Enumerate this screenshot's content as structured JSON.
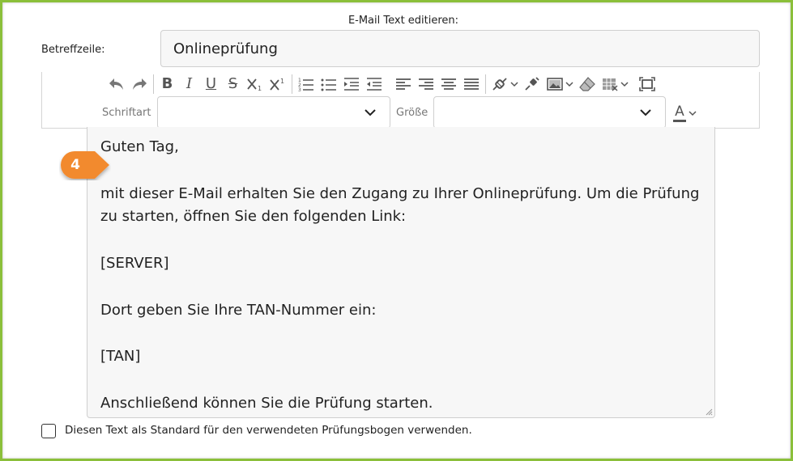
{
  "dialog": {
    "heading": "E-Mail Text editieren:"
  },
  "subject": {
    "label": "Betreffzeile:",
    "value": "Onlineprüfung"
  },
  "toolbar": {
    "buttons": [
      {
        "name": "undo-icon"
      },
      {
        "name": "redo-icon"
      },
      {
        "name": "bold-icon",
        "glyph": "B"
      },
      {
        "name": "italic-icon",
        "glyph": "I"
      },
      {
        "name": "underline-icon",
        "glyph": "U"
      },
      {
        "name": "strikethrough-icon",
        "glyph": "S"
      },
      {
        "name": "subscript-icon"
      },
      {
        "name": "superscript-icon"
      },
      {
        "name": "ordered-list-icon"
      },
      {
        "name": "unordered-list-icon"
      },
      {
        "name": "indent-icon"
      },
      {
        "name": "outdent-icon"
      },
      {
        "name": "align-left-icon"
      },
      {
        "name": "align-right-icon"
      },
      {
        "name": "align-center-icon"
      },
      {
        "name": "align-justify-icon"
      },
      {
        "name": "link-icon"
      },
      {
        "name": "unlink-icon"
      },
      {
        "name": "image-icon"
      },
      {
        "name": "eraser-icon"
      },
      {
        "name": "table-icon"
      },
      {
        "name": "fullscreen-icon"
      },
      {
        "name": "text-color-icon"
      }
    ],
    "font": {
      "label": "Schriftart",
      "value": ""
    },
    "size": {
      "label": "Größe",
      "value": ""
    },
    "text_color_glyph": "A",
    "text_color_value": "#555555"
  },
  "editor": {
    "paragraphs": [
      "Guten Tag,",
      "",
      "mit dieser E-Mail erhalten Sie den Zugang zu Ihrer Onlineprüfung. Um die Prüfung zu starten, öffnen Sie den folgenden Link:",
      "",
      "[SERVER]",
      "",
      "Dort geben Sie Ihre TAN-Nummer ein:",
      "",
      "[TAN]",
      "",
      "Anschließend können Sie die Prüfung starten."
    ]
  },
  "callout": {
    "number": "4",
    "color": "#f28a2e"
  },
  "default_checkbox": {
    "label": "Diesen Text als Standard für den verwendeten Prüfungsbogen verwenden.",
    "checked": false
  },
  "colors": {
    "frame_border": "#8bbf3a",
    "accent_callout": "#f28a2e"
  }
}
